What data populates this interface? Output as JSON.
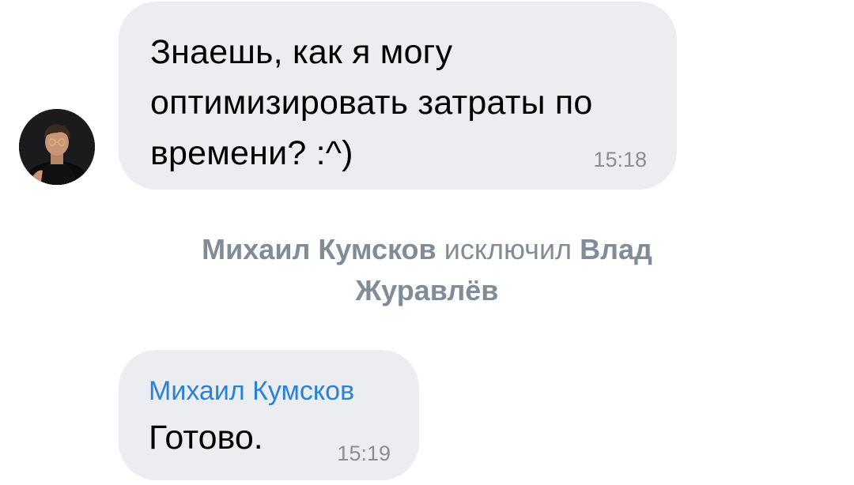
{
  "messages": [
    {
      "text": "Знаешь, как я могу оптимизировать затраты по времени? :^)",
      "time": "15:18"
    },
    {
      "sender": "Михаил Кумсков",
      "text": "Готово.",
      "time": "15:19"
    }
  ],
  "service": {
    "actor": "Михаил Кумсков",
    "action": "исключил",
    "target": "Влад Журавлёв"
  },
  "avatar": {
    "icon": "user-photo-icon"
  },
  "colors": {
    "bubble": "#ebedf0",
    "sender_name": "#2a81d8",
    "service_text": "#818c99",
    "time": "#8a8f96"
  }
}
